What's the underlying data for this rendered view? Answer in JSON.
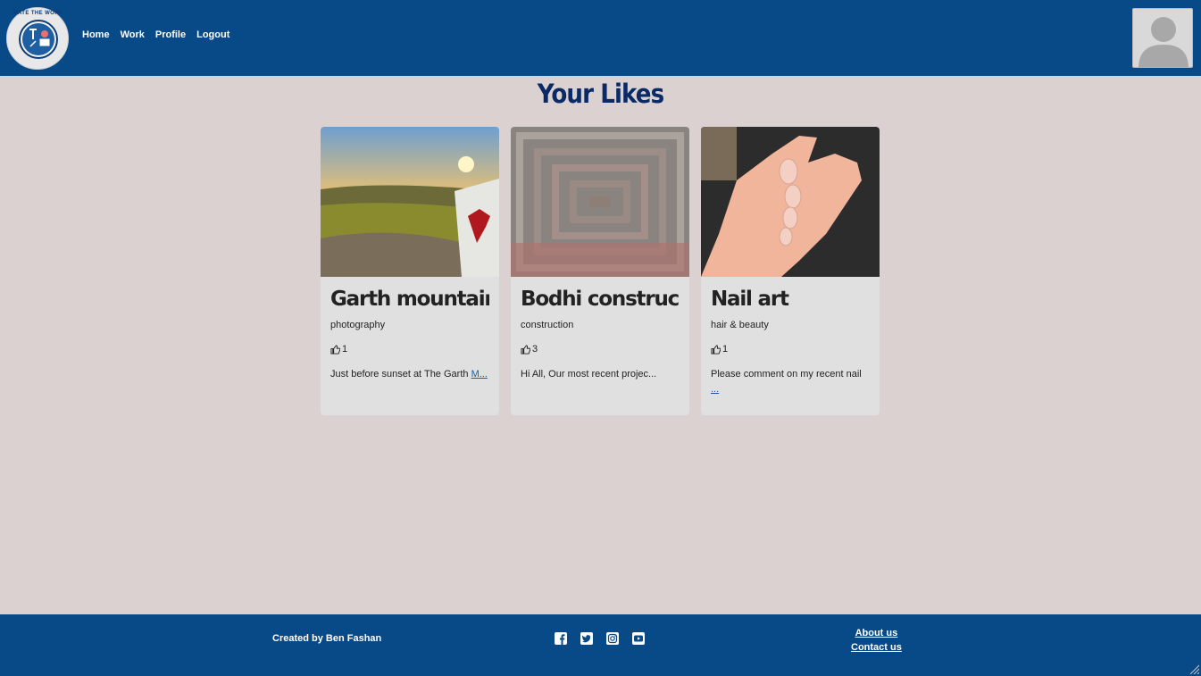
{
  "header": {
    "logo_text": "RATE THE WORK",
    "nav": [
      "Home",
      "Work",
      "Profile",
      "Logout"
    ]
  },
  "page": {
    "title": "Your Likes"
  },
  "cards": [
    {
      "title": "Garth mountain",
      "category": "photography",
      "likes": "1",
      "desc": "Just before sunset at The Garth ",
      "more": "M..."
    },
    {
      "title": "Bodhi construc...",
      "category": "construction",
      "likes": "3",
      "desc": "Hi All, Our most recent projec...",
      "more": ""
    },
    {
      "title": "Nail art",
      "category": "hair & beauty",
      "likes": "1",
      "desc": "Please comment on my recent nail ",
      "more": "..."
    }
  ],
  "footer": {
    "credit": "Created by Ben Fashan",
    "social": [
      "facebook-icon",
      "twitter-icon",
      "instagram-icon",
      "youtube-icon"
    ],
    "about": "About us",
    "contact": "Contact us"
  },
  "colors": {
    "header_bg": "#074a87",
    "page_bg": "#dbd1d1",
    "title": "#0a2a66"
  }
}
